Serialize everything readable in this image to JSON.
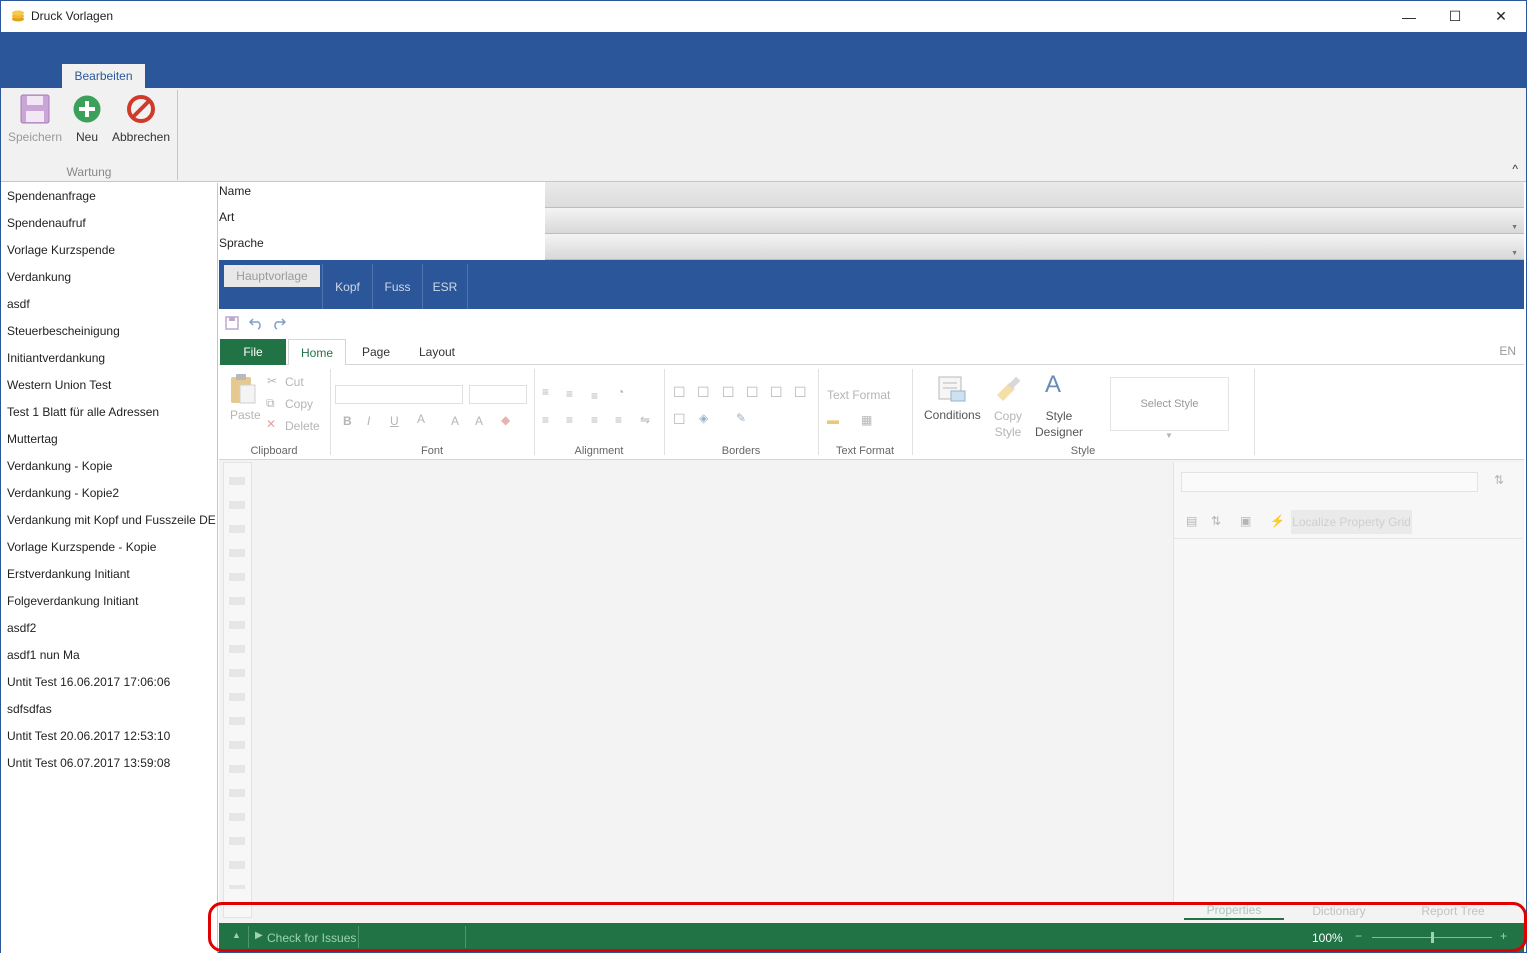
{
  "window": {
    "title": "Druck Vorlagen",
    "minimize": "—",
    "maximize": "☐",
    "close": "✕"
  },
  "ribbon": {
    "tab": "Bearbeiten",
    "buttons": {
      "save": "Speichern",
      "new": "Neu",
      "cancel": "Abbrechen"
    },
    "group": "Wartung",
    "collapse": "^"
  },
  "templates": [
    "Spendenanfrage",
    "Spendenaufruf",
    "Vorlage Kurzspende",
    "Verdankung",
    "asdf",
    "Steuerbescheinigung",
    "Initiantverdankung",
    "Western Union Test",
    "Test 1 Blatt für alle Adressen",
    "Muttertag",
    "Verdankung - Kopie",
    "Verdankung - Kopie2",
    "Verdankung mit Kopf und Fusszeile DE",
    "Vorlage Kurzspende - Kopie",
    "Erstverdankung Initiant",
    "Folgeverdankung Initiant",
    "asdf2",
    "asdf1 nun Ma",
    "Untit Test 16.06.2017 17:06:06",
    "sdfsdfas",
    "Untit Test 20.06.2017 12:53:10",
    "Untit Test 06.07.2017 13:59:08"
  ],
  "fields": {
    "name": "Name",
    "art": "Art",
    "sprache": "Sprache"
  },
  "doc_tabs": {
    "haupt": "Hauptvorlage",
    "kopf": "Kopf",
    "fuss": "Fuss",
    "esr": "ESR"
  },
  "designer": {
    "tabs": {
      "file": "File",
      "home": "Home",
      "page": "Page",
      "layout": "Layout"
    },
    "lang": "EN",
    "clipboard": {
      "paste": "Paste",
      "cut": "Cut",
      "copy": "Copy",
      "delete": "Delete",
      "label": "Clipboard"
    },
    "groups": {
      "font": "Font",
      "alignment": "Alignment",
      "borders": "Borders",
      "text_format": "Text Format",
      "style": "Style"
    },
    "text_format_btn": "Text Format",
    "conditions": "Conditions",
    "copy_style": [
      "Copy",
      "Style"
    ],
    "style_designer": [
      "Style",
      "Designer"
    ],
    "select_style": "Select Style",
    "localize": "Localize Property Grid",
    "panel_tabs": {
      "properties": "Properties",
      "dictionary": "Dictionary",
      "report_tree": "Report Tree"
    }
  },
  "status": {
    "check": "Check for Issues",
    "zoom": "100%",
    "minus": "−",
    "plus": "+"
  }
}
